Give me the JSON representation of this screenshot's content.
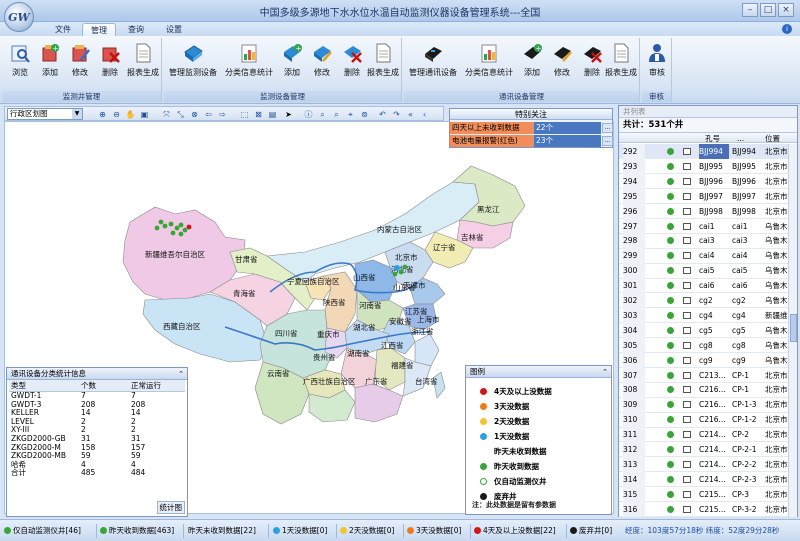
{
  "app": {
    "logo_text": "GW",
    "title": "中国多级多源地下水水位水温自动监测仪器设备管理系统---全国"
  },
  "tabs": [
    "文件",
    "管理",
    "查询",
    "设置"
  ],
  "ribbon": {
    "groups": [
      {
        "label": "监测井管理",
        "buttons": [
          "浏览",
          "添加",
          "修改",
          "删除",
          "报表生成"
        ]
      },
      {
        "label": "监测设备管理",
        "buttons": [
          "管理监测设备",
          "分类信息统计",
          "添加",
          "修改",
          "删除",
          "报表生成"
        ]
      },
      {
        "label": "通讯设备管理",
        "buttons": [
          "管理通讯设备",
          "分类信息统计",
          "添加",
          "修改",
          "删除",
          "报表生成"
        ]
      },
      {
        "label": "审核",
        "buttons": [
          "审核"
        ]
      }
    ]
  },
  "map_toolbar": {
    "region_select": "行政区划图"
  },
  "special": {
    "title": "特别关注",
    "rows": [
      {
        "key": "四天以上未收到数据",
        "value": "22个"
      },
      {
        "key": "电池电量报警(红色)",
        "value": "23个"
      }
    ]
  },
  "map": {
    "provinces": [
      "新疆维吾尔自治区",
      "西藏自治区",
      "青海省",
      "甘肃省",
      "内蒙古自治区",
      "黑龙江",
      "吉林省",
      "辽宁省",
      "北京市",
      "天津市",
      "河北省",
      "山西省",
      "山东省",
      "宁夏回族自治区",
      "陕西省",
      "河南省",
      "江苏省",
      "上海市",
      "四川省",
      "重庆市",
      "湖北省",
      "安徽省",
      "浙江省",
      "江西省",
      "湖南省",
      "贵州省",
      "云南省",
      "广西壮族自治区",
      "广东省",
      "福建省",
      "台湾省"
    ],
    "colors": {
      "xinjiang": "#f0c9e6",
      "tibet": "#c9e4f4",
      "qinghai": "#f5d3e3",
      "gansu": "#e2efc7",
      "neimenggu": "#d8edf6",
      "heilongjiang": "#dbe9c4",
      "jilin": "#f4cfe6",
      "liaoning": "#f1ecb4",
      "hebei": "#c9dcf0",
      "shanxi": "#8db8e8",
      "shandong": "#a9c9ec",
      "ningxia": "#f7e5b8",
      "shaanxi": "#f2d8b6",
      "henan": "#cfe3bf",
      "jiangsu": "#9cb8e6",
      "sichuan": "#c6e4dc",
      "chongqing": "#e6d8f0",
      "hubei": "#c4dcf2",
      "anhui": "#bcd8f2",
      "zhejiang": "#d6e6f8",
      "jiangxi": "#e3e8c0",
      "hunan": "#f2d3da",
      "guizhou": "#e6e7ba",
      "yunnan": "#cfe6c1",
      "guangxi": "#d3ead1",
      "guangdong": "#e6cce8",
      "fujian": "#dce8f6",
      "taiwan": "#c8e2f2",
      "river": "#3b78c9",
      "border": "#777777"
    }
  },
  "stats": {
    "title": "通讯设备分类统计信息",
    "columns": [
      "类型",
      "个数",
      "正常运行"
    ],
    "rows": [
      [
        "GWDT-1",
        "7",
        "7"
      ],
      [
        "GWDT-3",
        "208",
        "208"
      ],
      [
        "KELLER",
        "14",
        "14"
      ],
      [
        "LEVEL",
        "2",
        "2"
      ],
      [
        "XY-III",
        "2",
        "2"
      ],
      [
        "ZKGD2000-GB",
        "31",
        "31"
      ],
      [
        "ZKGD2000-M",
        "158",
        "157"
      ],
      [
        "ZKGD2000-MB",
        "59",
        "59"
      ],
      [
        "哈希",
        "4",
        "4"
      ],
      [
        "合计",
        "485",
        "484"
      ]
    ],
    "footer": "统计图"
  },
  "legend": {
    "title": "图例",
    "items": [
      {
        "label": "4天及以上没数据",
        "color": "#d01818"
      },
      {
        "label": "3天没数据",
        "color": "#f07a1a"
      },
      {
        "label": "2天没数据",
        "color": "#f2c230"
      },
      {
        "label": "1天没数据",
        "color": "#2ea0e0"
      },
      {
        "label": "昨天未收到数据",
        "color": "#ffffff"
      },
      {
        "label": "昨天收到数据",
        "color": "#3aa537"
      },
      {
        "label": "仅自动监测仪井",
        "color": "#ffffff"
      },
      {
        "label": "废弃井",
        "color": "#1a1a1a"
      }
    ],
    "note": "注：此处数据是留有参数据"
  },
  "wells": {
    "header": "井列表",
    "total": "共计：531个井",
    "columns": [
      "孔号",
      "位置"
    ],
    "rows": [
      [
        "292",
        "BJJ994",
        "BJJ994",
        "北京市"
      ],
      [
        "293",
        "BJJ995",
        "BJJ995",
        "北京市"
      ],
      [
        "294",
        "BJJ996",
        "BJJ996",
        "北京市"
      ],
      [
        "295",
        "BJJ997",
        "BJJ997",
        "北京市"
      ],
      [
        "296",
        "BJJ998",
        "BJJ998",
        "北京市"
      ],
      [
        "297",
        "cai1",
        "cai1",
        "乌鲁木"
      ],
      [
        "298",
        "cai3",
        "cai3",
        "乌鲁木"
      ],
      [
        "299",
        "cai4",
        "cai4",
        "乌鲁木"
      ],
      [
        "300",
        "cai5",
        "cai5",
        "乌鲁木"
      ],
      [
        "301",
        "cai6",
        "cai6",
        "乌鲁木"
      ],
      [
        "302",
        "cg2",
        "cg2",
        "乌鲁木"
      ],
      [
        "303",
        "cg4",
        "cg4",
        "新疆维"
      ],
      [
        "304",
        "cg5",
        "cg5",
        "乌鲁木"
      ],
      [
        "305",
        "cg8",
        "cg8",
        "乌鲁木"
      ],
      [
        "306",
        "cg9",
        "cg9",
        "乌鲁木"
      ],
      [
        "307",
        "C213...",
        "CP-1",
        "北京市"
      ],
      [
        "308",
        "C216...",
        "CP-1",
        "北京市"
      ],
      [
        "309",
        "C216...",
        "CP-1-3",
        "北京市"
      ],
      [
        "310",
        "C216...",
        "CP-1-2",
        "北京市"
      ],
      [
        "311",
        "C214...",
        "CP-2",
        "北京市"
      ],
      [
        "312",
        "C214...",
        "CP-2-1",
        "北京市"
      ],
      [
        "313",
        "C214...",
        "CP-2-2",
        "北京市"
      ],
      [
        "314",
        "C214...",
        "CP-2-3",
        "北京市"
      ],
      [
        "315",
        "C215...",
        "CP-3",
        "北京市"
      ],
      [
        "316",
        "C215...",
        "CP-3-2",
        "北京市"
      ]
    ]
  },
  "statusbar": {
    "items": [
      {
        "label": "仅自动监测仪井[46]",
        "color": "#3aa537"
      },
      {
        "label": "昨天收到数据[463]",
        "color": "#3aa537"
      },
      {
        "label": "昨天未收到数据[22]",
        "color": ""
      },
      {
        "label": "1天没数据[0]",
        "color": "#2ea0e0"
      },
      {
        "label": "2天没数据[0]",
        "color": "#f2c230"
      },
      {
        "label": "3天没数据[0]",
        "color": "#f07a1a"
      },
      {
        "label": "4天及以上没数据[22]",
        "color": "#d01818"
      },
      {
        "label": "废弃井[0]",
        "color": "#1a1a1a"
      }
    ],
    "coords": "经度：103度57分18秒  纬度：52度29分28秒"
  }
}
